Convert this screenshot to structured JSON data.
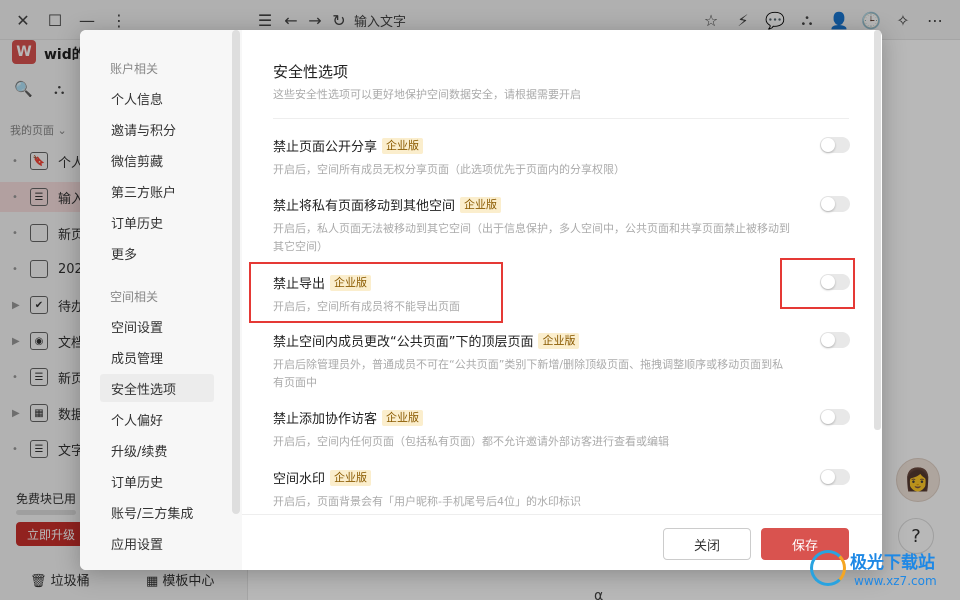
{
  "app": {
    "doc_title": "输入文字",
    "workspace_logo": "W",
    "workspace_name": "wid的",
    "my_pages_label": "我的页面 ⌄",
    "pages": [
      {
        "label": "个人",
        "icon": "bookmark-icon",
        "active": false,
        "glyph": "🔖"
      },
      {
        "label": "输入",
        "icon": "doc-icon",
        "active": true,
        "glyph": "☰"
      },
      {
        "label": "新页",
        "icon": "blank-page-icon",
        "active": false,
        "glyph": ""
      },
      {
        "label": "202",
        "icon": "blank-page-icon",
        "active": false,
        "glyph": ""
      },
      {
        "label": "待办",
        "icon": "checkbox-icon",
        "active": false,
        "glyph": "✔"
      },
      {
        "label": "文档",
        "icon": "target-icon",
        "active": false,
        "glyph": "◉"
      },
      {
        "label": "新页",
        "icon": "doc-icon",
        "active": false,
        "glyph": "☰"
      },
      {
        "label": "数据",
        "icon": "table-icon",
        "active": false,
        "glyph": "▦"
      },
      {
        "label": "文字",
        "icon": "doc-icon",
        "active": false,
        "glyph": "☰"
      }
    ],
    "free_label": "免费块已用",
    "upgrade_label": "立即升级",
    "trash_label": "垃圾桶",
    "template_label": "模板中心",
    "alpha_char": "α"
  },
  "modal": {
    "account_section": "账户相关",
    "account_items": [
      "个人信息",
      "邀请与积分",
      "微信剪藏",
      "第三方账户",
      "订单历史",
      "更多"
    ],
    "space_section": "空间相关",
    "space_items": [
      "空间设置",
      "成员管理",
      "安全性选项",
      "个人偏好",
      "升级/续费",
      "订单历史",
      "账号/三方集成",
      "应用设置"
    ],
    "active_item": "安全性选项",
    "title": "安全性选项",
    "subtitle": "这些安全性选项可以更好地保护空间数据安全，请根据需要开启",
    "options": [
      {
        "title": "禁止页面公开分享",
        "badge": "企业版",
        "desc": "开启后，空间所有成员无权分享页面（此选项优先于页面内的分享权限）",
        "enabled": false
      },
      {
        "title": "禁止将私有页面移动到其他空间",
        "badge": "企业版",
        "desc": "开启后，私人页面无法被移动到其它空间（出于信息保护，多人空间中，公共页面和共享页面禁止被移动到其它空间）",
        "enabled": false
      },
      {
        "title": "禁止导出",
        "badge": "企业版",
        "desc": "开启后，空间所有成员将不能导出页面",
        "enabled": false
      },
      {
        "title": "禁止空间内成员更改“公共页面”下的顶层页面",
        "badge": "企业版",
        "desc": "开启后除管理员外，普通成员不可在“公共页面”类别下新增/删除顶级页面、拖拽调整顺序或移动页面到私有页面中",
        "enabled": false
      },
      {
        "title": "禁止添加协作访客",
        "badge": "企业版",
        "desc": "开启后，空间内任何页面（包括私有页面）都不允许邀请外部访客进行查看或编辑",
        "enabled": false
      },
      {
        "title": "空间水印",
        "badge": "企业版",
        "desc": "开启后，页面背景会有「用户昵称-手机尾号后4位」的水印标识",
        "enabled": false
      }
    ],
    "close_label": "关闭",
    "save_label": "保存"
  },
  "watermark": {
    "title": "极光下载站",
    "url": "www.xz7.com"
  },
  "colors": {
    "accent": "#d9534f",
    "badge_bg": "#fbeecd",
    "highlight": "#e53935"
  }
}
